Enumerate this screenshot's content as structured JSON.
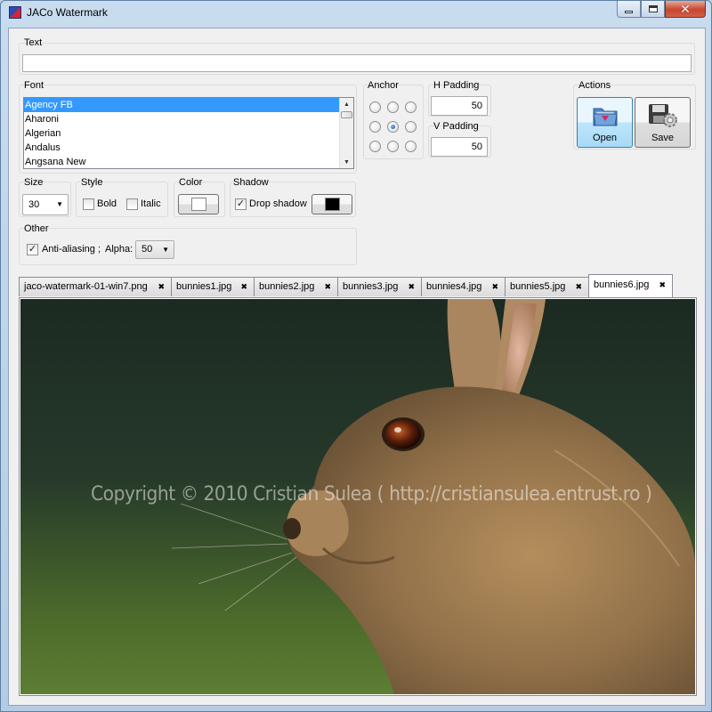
{
  "window": {
    "title": "JACo Watermark",
    "close_glyph": "✕"
  },
  "text_section": {
    "label": "Text",
    "value": ""
  },
  "font_section": {
    "label": "Font",
    "items": [
      "Agency FB",
      "Aharoni",
      "Algerian",
      "Andalus",
      "Angsana New"
    ],
    "selected": "Agency FB"
  },
  "anchor_section": {
    "label": "Anchor",
    "selected_position": "center"
  },
  "h_padding": {
    "label": "H Padding",
    "value": "50"
  },
  "v_padding": {
    "label": "V Padding",
    "value": "50"
  },
  "actions": {
    "label": "Actions",
    "open_label": "Open",
    "save_label": "Save"
  },
  "size_section": {
    "label": "Size",
    "value": "30"
  },
  "style_section": {
    "label": "Style",
    "bold_label": "Bold",
    "bold_checked": false,
    "italic_label": "Italic",
    "italic_checked": false
  },
  "color_section": {
    "label": "Color",
    "color": "#ffffff"
  },
  "shadow_section": {
    "label": "Shadow",
    "drop_shadow_label": "Drop shadow",
    "drop_shadow_checked": true,
    "shadow_color": "#000000"
  },
  "other_section": {
    "label": "Other",
    "anti_aliasing_label": "Anti-aliasing ;",
    "anti_aliasing_checked": true,
    "alpha_label": "Alpha:",
    "alpha_value": "50"
  },
  "tabs": [
    {
      "label": "jaco-watermark-01-win7.png",
      "active": false
    },
    {
      "label": "bunnies1.jpg",
      "active": false
    },
    {
      "label": "bunnies2.jpg",
      "active": false
    },
    {
      "label": "bunnies3.jpg",
      "active": false
    },
    {
      "label": "bunnies4.jpg",
      "active": false
    },
    {
      "label": "bunnies5.jpg",
      "active": false
    },
    {
      "label": "bunnies6.jpg",
      "active": true
    }
  ],
  "tab_close_glyph": "✖",
  "preview": {
    "watermark_text": "Copyright © 2010 Cristian Sulea ( http://cristiansulea.entrust.ro )"
  },
  "colors": {
    "selection": "#3399ff",
    "title_bar": "#c9dcef",
    "close_button": "#c7452e"
  },
  "icons": {
    "minimize": "minimize-icon",
    "maximize": "maximize-icon",
    "close": "close-icon",
    "open": "folder-icon",
    "save": "disk-gear-icon"
  }
}
